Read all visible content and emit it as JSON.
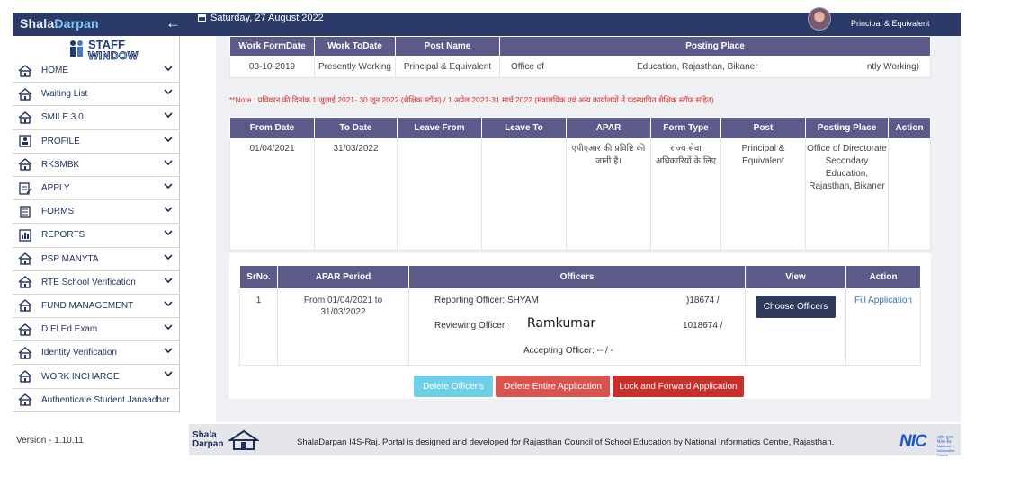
{
  "header": {
    "brand_prefix": "Shala",
    "brand_suffix": "Darpan",
    "back_icon": "back-arrow-icon",
    "date": "Saturday, 27 August 2022",
    "role": "Principal & Equivalent"
  },
  "sidebar": {
    "logo_line1": "STAFF",
    "logo_line2": "WINDOW",
    "items": [
      {
        "label": "HOME",
        "icon": "home-icon"
      },
      {
        "label": "Waiting List",
        "icon": "home-icon"
      },
      {
        "label": "SMILE 3.0",
        "icon": "home-icon"
      },
      {
        "label": "PROFILE",
        "icon": "profile-icon"
      },
      {
        "label": "RKSMBK",
        "icon": "home-icon"
      },
      {
        "label": "APPLY",
        "icon": "apply-icon"
      },
      {
        "label": "FORMS",
        "icon": "forms-icon"
      },
      {
        "label": "REPORTS",
        "icon": "reports-icon"
      },
      {
        "label": "PSP MANYTA",
        "icon": "home-icon"
      },
      {
        "label": "RTE School Verification",
        "icon": "home-icon"
      },
      {
        "label": "FUND MANAGEMENT",
        "icon": "home-icon"
      },
      {
        "label": "D.El.Ed Exam",
        "icon": "home-icon"
      },
      {
        "label": "Identity Verification",
        "icon": "home-icon"
      },
      {
        "label": "WORK INCHARGE",
        "icon": "home-icon"
      },
      {
        "label": "Authenticate Student Janaadhar",
        "icon": "home-icon"
      }
    ],
    "version": "Version - 1.10.11"
  },
  "work_table": {
    "headers": [
      "Work FormDate",
      "Work ToDate",
      "Post Name",
      "Posting Place"
    ],
    "row": {
      "from": "03-10-2019",
      "to": "Presently Working",
      "post": "Principal & Equivalent",
      "place_a": "Office of",
      "place_b": "Education, Rajasthan, Bikaner",
      "place_c": "ntly Working)"
    }
  },
  "note": "**Note : प्रविवरन की दिनांक 1 जुलाई 2021- 30 जून 2022 (शैक्षिक स्टॉफ) / 1 अप्रेल 2021-31 मार्च 2022 (मंत्रालयिक एवं अन्य कार्यालयों में पदस्थापित शैक्षिक स्टॉफ सहित)",
  "apar_table": {
    "headers": [
      "From Date",
      "To Date",
      "Leave From",
      "Leave To",
      "APAR",
      "Form Type",
      "Post",
      "Posting Place",
      "Action"
    ],
    "row": {
      "from": "01/04/2021",
      "to": "31/03/2022",
      "leave_from": "",
      "leave_to": "",
      "apar": "एपीएआर की प्रविष्टि की जानी है।",
      "form_type": "राज्य सेवा अधिकारियों के लिए",
      "post": "Principal & Equivalent",
      "place": "Office of Directorate Secondary Education, Rajasthan, Bikaner",
      "action": ""
    }
  },
  "officer_table": {
    "headers": [
      "SrNo.",
      "APAR Period",
      "Officers",
      "View",
      "Action"
    ],
    "row": {
      "srno": "1",
      "period": "From 01/04/2021 to 31/03/2022",
      "reporting_label": "Reporting Officer: SHYAM",
      "reporting_id": ")18674 /",
      "reviewing_label": "Reviewing Officer:",
      "reviewing_name": "Ramkumar",
      "reviewing_id": "1018674 /",
      "accepting": "Accepting Officer: -- / -",
      "view_button": "Choose Officers",
      "action_link": "Fill Application"
    }
  },
  "actions": {
    "delete_officers": "Delete Officer's",
    "delete_application": "Delete Entire Application",
    "lock_forward": "Lock and Forward Application"
  },
  "footer": {
    "logo_line1": "Shala",
    "logo_line2": "Darpan",
    "text": "ShalaDarpan I4S-Raj. Portal is designed and developed for Rajasthan Council of School Education by National Informatics Centre, Rajasthan.",
    "nic": "NIC",
    "nic_sub": "राष्ट्रीय सूचना विज्ञान केंद्र National Informatics Centre"
  }
}
